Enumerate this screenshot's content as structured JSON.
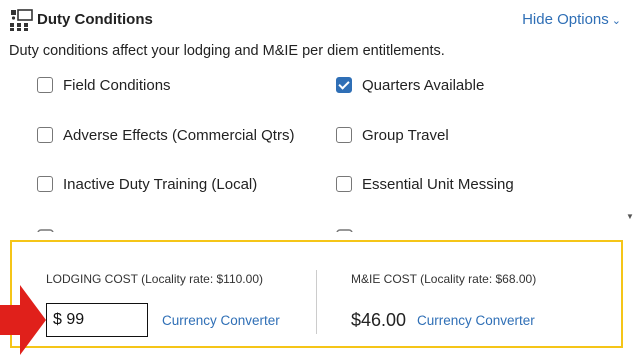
{
  "duty_conditions": {
    "title": "Duty Conditions",
    "hide_options": "Hide Options",
    "description": "Duty conditions affect your lodging and M&IE per diem entitlements.",
    "options": [
      {
        "label": "Field Conditions",
        "checked": false
      },
      {
        "label": "Quarters Available",
        "checked": true
      },
      {
        "label": "Adverse Effects (Commercial Qtrs)",
        "checked": false
      },
      {
        "label": "Group Travel",
        "checked": false
      },
      {
        "label": "Inactive Duty Training (Local)",
        "checked": false
      },
      {
        "label": "Essential Unit Messing",
        "checked": false
      }
    ]
  },
  "lodging": {
    "title": "LODGING COST",
    "locality": "(Locality rate: $110.00)",
    "input_value": "$ 99",
    "currency_converter": "Currency Converter"
  },
  "mie": {
    "title": "M&IE COST",
    "locality": "(Locality rate: $68.00)",
    "value": "$46.00",
    "currency_converter": "Currency Converter"
  },
  "colors": {
    "link": "#2f6fb6",
    "highlight_border": "#f5c518",
    "arrow": "#e0201b",
    "checkbox_checked": "#2f6fb6"
  }
}
